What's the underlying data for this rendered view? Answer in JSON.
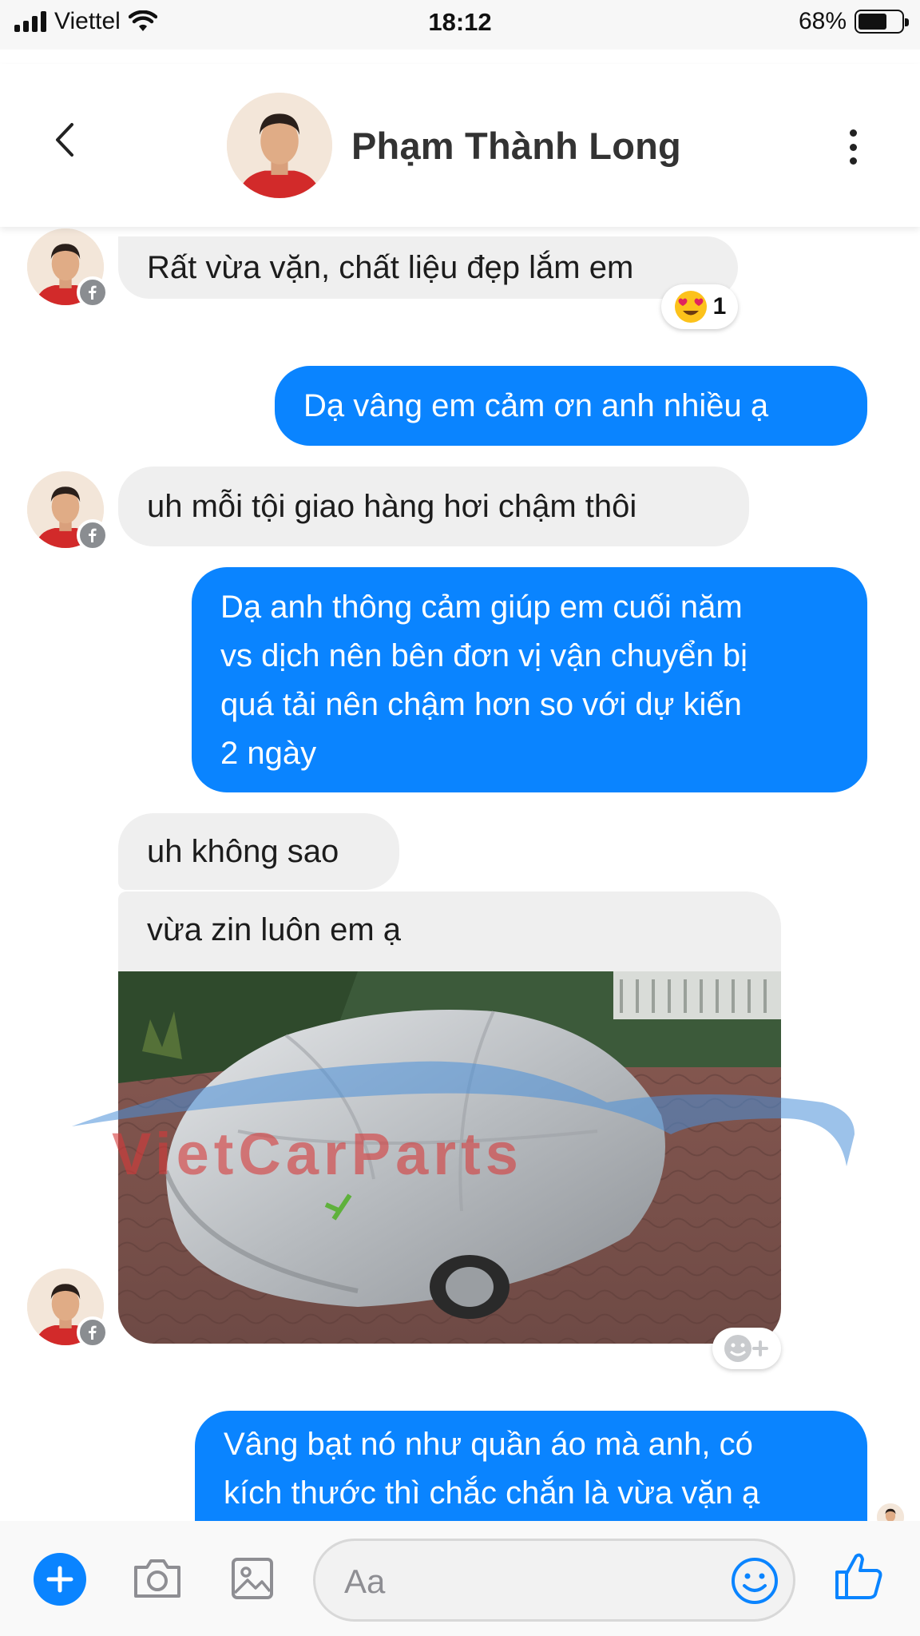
{
  "status_bar": {
    "carrier": "Viettel",
    "time": "18:12",
    "battery": "68%",
    "battery_level": 0.68
  },
  "header": {
    "contact_name": "Phạm Thành Long"
  },
  "messages": [
    {
      "side": "incoming",
      "text": "Rất vừa vặn, chất liệu đẹp lắm em",
      "reaction": {
        "emoji": "heart-eyes",
        "count": "1"
      }
    },
    {
      "side": "outgoing",
      "text": "Dạ vâng em cảm ơn anh nhiều ạ"
    },
    {
      "side": "incoming",
      "text": "uh mỗi tội giao hàng hơi chậm thôi"
    },
    {
      "side": "outgoing",
      "lines": [
        "Dạ anh thông cảm giúp em cuối năm",
        "vs dịch nên bên đơn vị vận chuyển bị",
        "quá tải nên chậm hơn so với dự kiến",
        "2 ngày"
      ]
    },
    {
      "side": "incoming",
      "text": "uh không sao"
    },
    {
      "side": "incoming",
      "text": "vừa zin luôn em ạ"
    },
    {
      "side": "incoming",
      "type": "photo",
      "subject": "car-cover-photo"
    },
    {
      "side": "outgoing",
      "lines": [
        "Vâng bạt nó như quần áo mà anh, có",
        "kích thước thì chắc chắn là vừa vặn ạ"
      ]
    }
  ],
  "watermark": {
    "text": "VietCarParts"
  },
  "composer": {
    "placeholder": "Aa"
  },
  "colors": {
    "accent": "#0a84ff",
    "incoming_bubble": "#efefef",
    "watermark_red": "#d63a3a",
    "watermark_blue": "#4a90d9"
  }
}
